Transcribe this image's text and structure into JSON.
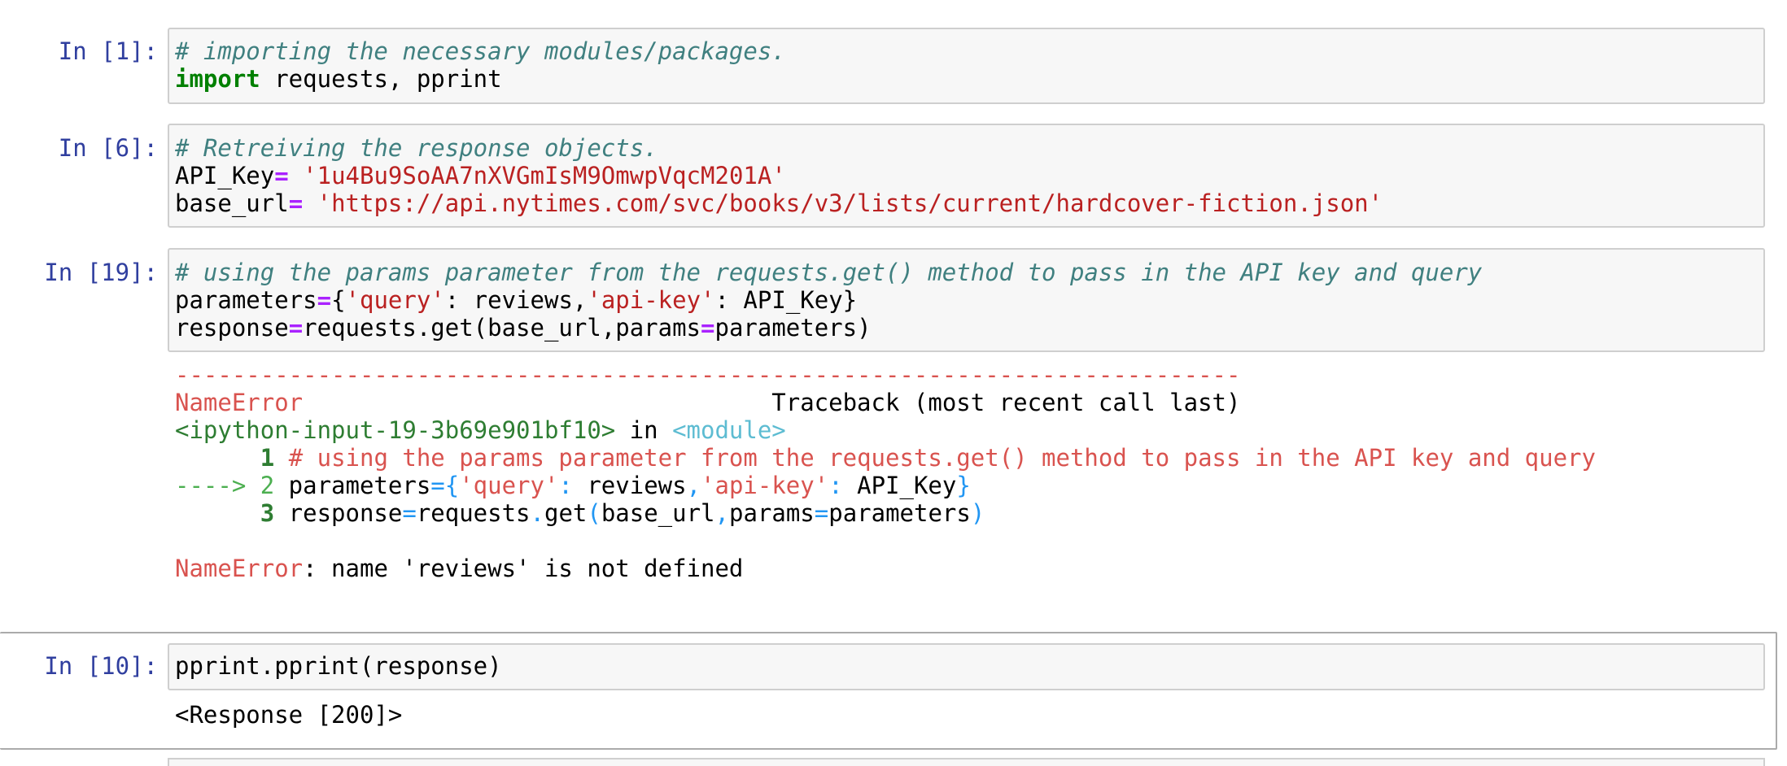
{
  "cells": [
    {
      "prompt": "In [1]:",
      "lines": [
        [
          {
            "t": "cm",
            "v": "# importing the necessary modules/packages."
          }
        ],
        [
          {
            "t": "kw",
            "v": "import"
          },
          {
            "t": "n",
            "v": " requests, pprint"
          }
        ]
      ]
    },
    {
      "prompt": "In [6]:",
      "lines": [
        [
          {
            "t": "cm",
            "v": "# Retreiving the response objects."
          }
        ],
        [
          {
            "t": "n",
            "v": "API_Key"
          },
          {
            "t": "op",
            "v": "="
          },
          {
            "t": "n",
            "v": " "
          },
          {
            "t": "st",
            "v": "'1u4Bu9SoAA7nXVGmIsM9OmwpVqcM201A'"
          }
        ],
        [
          {
            "t": "n",
            "v": "base_url"
          },
          {
            "t": "op",
            "v": "="
          },
          {
            "t": "n",
            "v": " "
          },
          {
            "t": "st",
            "v": "'https://api.nytimes.com/svc/books/v3/lists/current/hardcover-fiction.json'"
          }
        ]
      ]
    },
    {
      "prompt": "In [19]:",
      "lines": [
        [
          {
            "t": "cm",
            "v": "# using the params parameter from the requests.get() method to pass in the API key and query"
          }
        ],
        [
          {
            "t": "n",
            "v": "parameters"
          },
          {
            "t": "op",
            "v": "="
          },
          {
            "t": "n",
            "v": "{"
          },
          {
            "t": "st",
            "v": "'query'"
          },
          {
            "t": "n",
            "v": ": reviews,"
          },
          {
            "t": "st",
            "v": "'api-key'"
          },
          {
            "t": "n",
            "v": ": API_Key}"
          }
        ],
        [
          {
            "t": "n",
            "v": "response"
          },
          {
            "t": "op",
            "v": "="
          },
          {
            "t": "n",
            "v": "requests.get(base_url,params"
          },
          {
            "t": "op",
            "v": "="
          },
          {
            "t": "n",
            "v": "parameters)"
          }
        ]
      ],
      "output": [
        [
          {
            "t": "tb-red",
            "v": "---------------------------------------------------------------------------"
          }
        ],
        [
          {
            "t": "tb-red",
            "v": "NameError"
          },
          {
            "t": "n",
            "v": "                                 Traceback (most recent call last)"
          }
        ],
        [
          {
            "t": "tb-green",
            "v": "<ipython-input-19-3b69e901bf10>"
          },
          {
            "t": "n",
            "v": " in "
          },
          {
            "t": "tb-cyan",
            "v": "<module>"
          }
        ],
        [
          {
            "t": "tb-boldg",
            "v": "      1"
          },
          {
            "t": "n",
            "v": " "
          },
          {
            "t": "tb-red",
            "v": "# using the params parameter from the requests.get() method to pass in the API key and query"
          }
        ],
        [
          {
            "t": "tb-lg",
            "v": "----> 2"
          },
          {
            "t": "n",
            "v": " parameters"
          },
          {
            "t": "tb-blue",
            "v": "={"
          },
          {
            "t": "tb-red",
            "v": "'query'"
          },
          {
            "t": "tb-blue",
            "v": ":"
          },
          {
            "t": "n",
            "v": " reviews"
          },
          {
            "t": "tb-blue",
            "v": ","
          },
          {
            "t": "tb-red",
            "v": "'api-key'"
          },
          {
            "t": "tb-blue",
            "v": ":"
          },
          {
            "t": "n",
            "v": " API_Key"
          },
          {
            "t": "tb-blue",
            "v": "}"
          }
        ],
        [
          {
            "t": "tb-boldg",
            "v": "      3"
          },
          {
            "t": "n",
            "v": " response"
          },
          {
            "t": "tb-blue",
            "v": "="
          },
          {
            "t": "n",
            "v": "requests"
          },
          {
            "t": "tb-blue",
            "v": "."
          },
          {
            "t": "n",
            "v": "get"
          },
          {
            "t": "tb-blue",
            "v": "("
          },
          {
            "t": "n",
            "v": "base_url"
          },
          {
            "t": "tb-blue",
            "v": ","
          },
          {
            "t": "n",
            "v": "params"
          },
          {
            "t": "tb-blue",
            "v": "="
          },
          {
            "t": "n",
            "v": "parameters"
          },
          {
            "t": "tb-blue",
            "v": ")"
          }
        ],
        [
          {
            "t": "n",
            "v": ""
          }
        ],
        [
          {
            "t": "tb-red",
            "v": "NameError"
          },
          {
            "t": "n",
            "v": ": name 'reviews' is not defined"
          }
        ]
      ]
    },
    {
      "prompt": "In [10]:",
      "lines": [
        [
          {
            "t": "n",
            "v": "pprint.pprint(response)"
          }
        ]
      ],
      "output": [
        [
          {
            "t": "n",
            "v": "<Response [200]>"
          }
        ]
      ]
    }
  ]
}
